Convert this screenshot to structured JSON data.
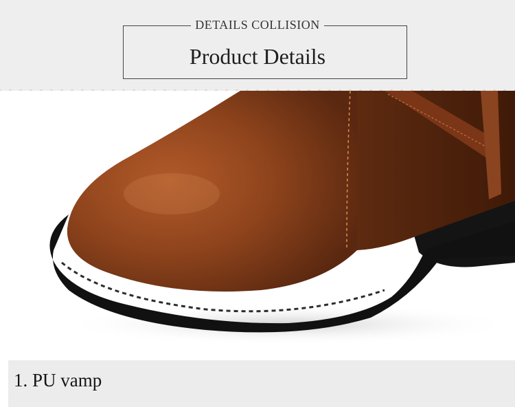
{
  "header": {
    "caption": "DETAILS COLLISION",
    "title": "Product Details"
  },
  "image": {
    "subject": "brown-leather-boot-toe",
    "colors": {
      "leather": "#8a3f1a",
      "sole": "#1a1a1a",
      "background": "#eeeeee"
    }
  },
  "feature": {
    "label": "1. PU vamp"
  }
}
